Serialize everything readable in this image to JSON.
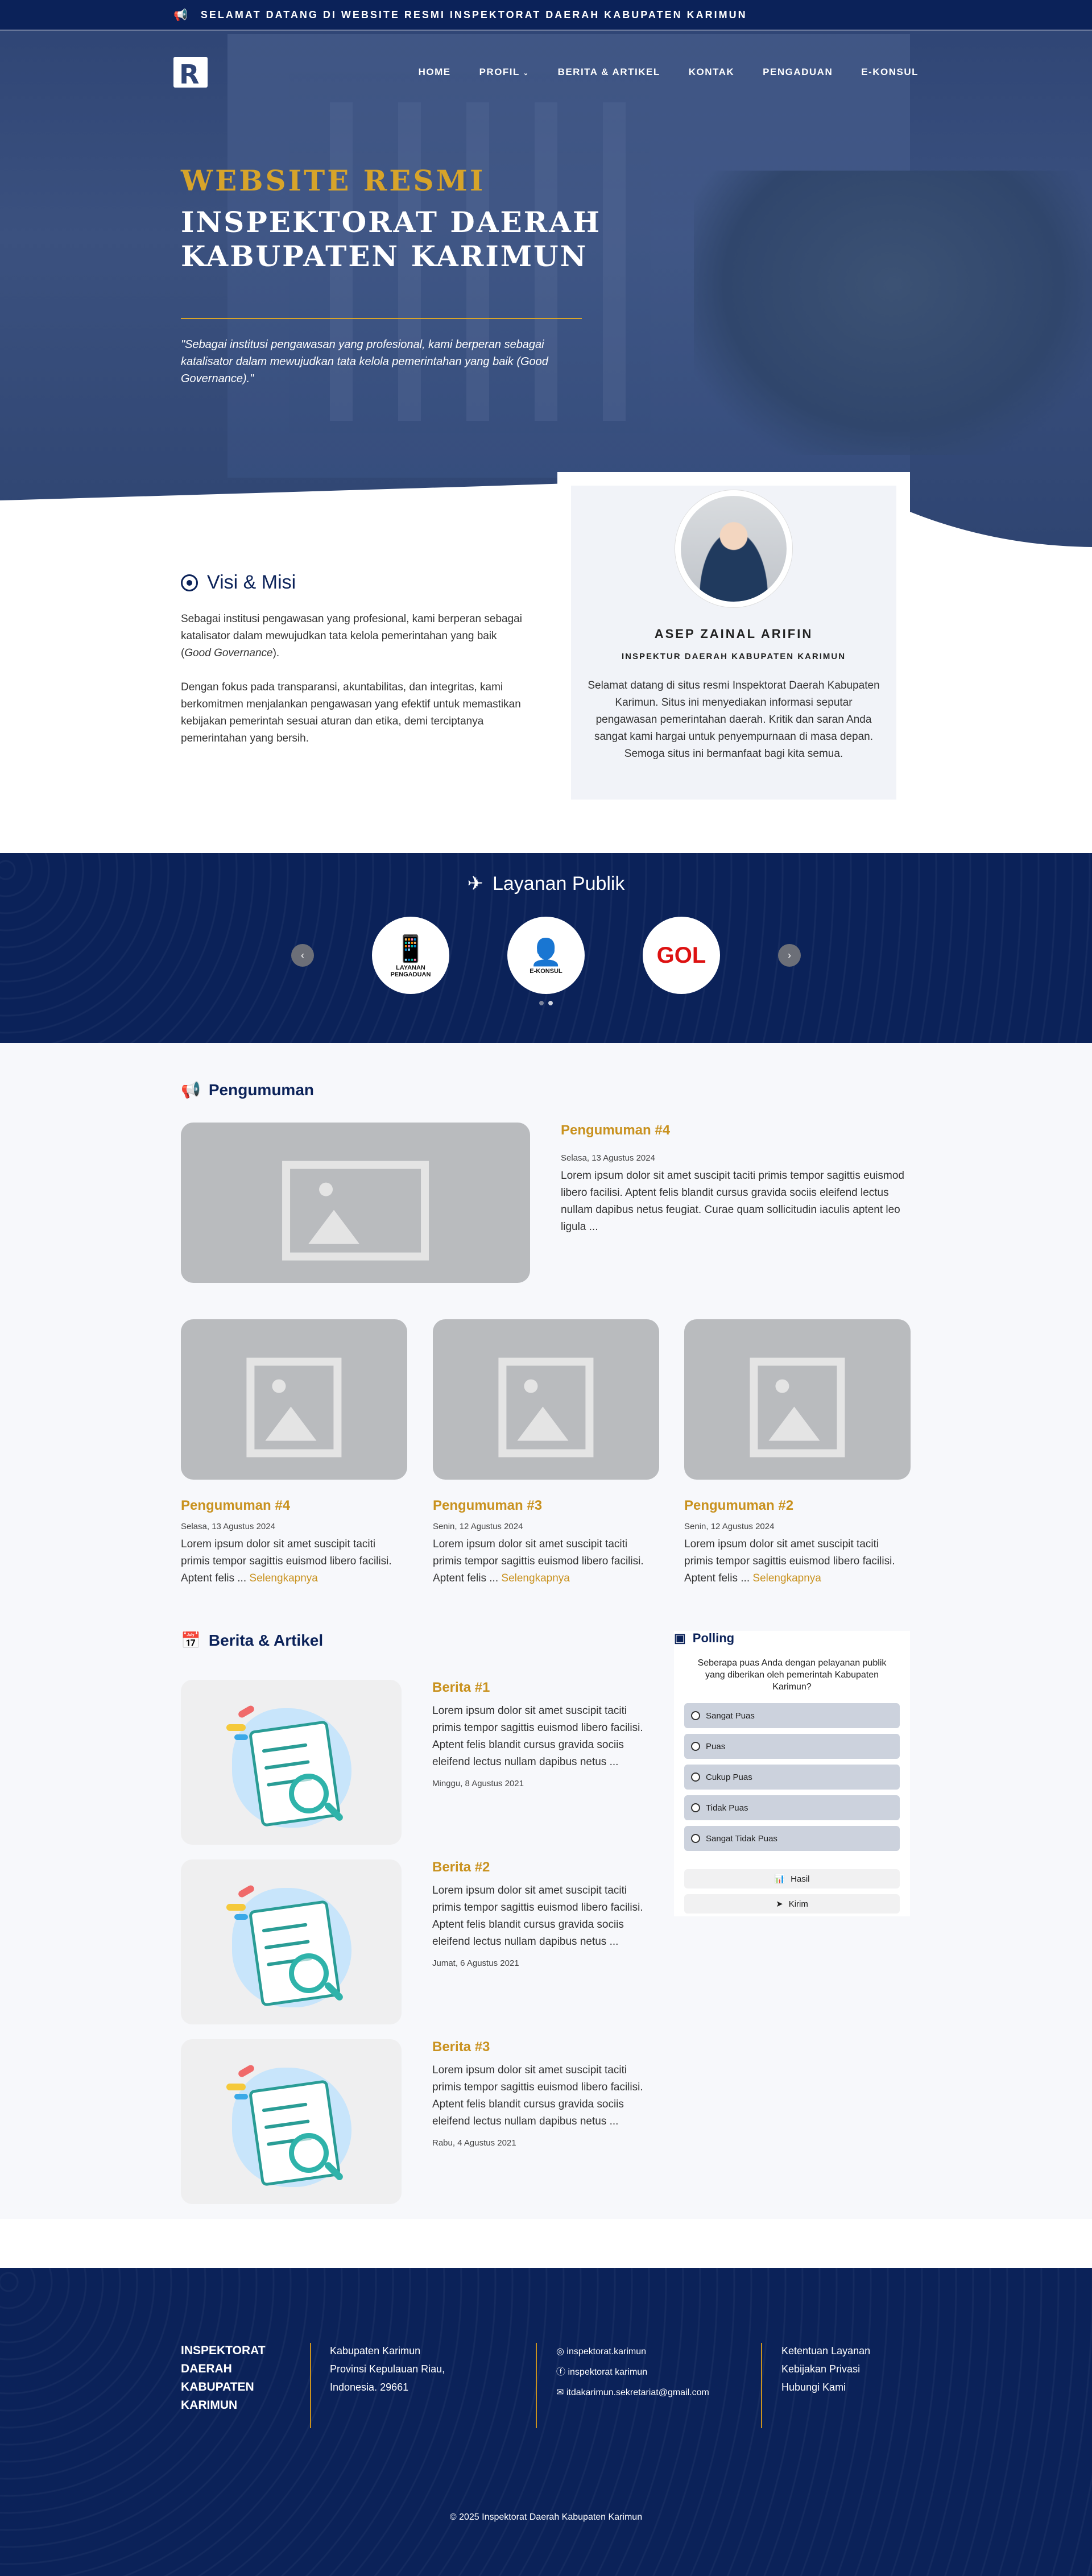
{
  "topbar": {
    "icon": "megaphone-icon",
    "text": "SELAMAT DATANG DI WEBSITE RESMI INSPEKTORAT DAERAH KABUPATEN KARIMUN"
  },
  "nav": {
    "items": [
      "HOME",
      "PROFIL",
      "BERITA & ARTIKEL",
      "KONTAK",
      "PENGADUAN",
      "E-KONSUL"
    ]
  },
  "hero": {
    "kicker": "WEBSITE RESMI",
    "title": "INSPEKTORAT DAERAH KABUPATEN KARIMUN",
    "quote": "\"Sebagai institusi pengawasan yang profesional, kami berperan sebagai katalisator dalam mewujudkan tata kelola pemerintahan yang baik (Good Governance).\""
  },
  "profile": {
    "name": "ASEP ZAINAL ARIFIN",
    "role": "INSPEKTUR DAERAH KABUPATEN KARIMUN",
    "message": "Selamat datang di situs resmi Inspektorat Daerah Kabupaten Karimun. Situs ini menyediakan informasi seputar pengawasan pemerintahan daerah. Kritik dan saran Anda sangat kami hargai untuk penyempurnaan di masa depan. Semoga situs ini bermanfaat bagi kita semua."
  },
  "visi": {
    "title": "Visi & Misi",
    "p1_pre": "Sebagai institusi pengawasan yang profesional, kami berperan sebagai katalisator dalam mewujudkan tata kelola pemerintahan yang baik (",
    "p1_em": "Good Governance",
    "p1_post": ").",
    "p2": "Dengan fokus pada transparansi, akuntabilitas, dan integritas, kami berkomitmen menjalankan pengawasan yang efektif untuk memastikan kebijakan pemerintah sesuai aturan dan etika, demi terciptanya pemerintahan yang bersih."
  },
  "layanan": {
    "title": "Layanan Publik",
    "items": [
      {
        "label": "LAYANAN PENGADUAN",
        "icon": "phone-hand-icon"
      },
      {
        "label": "E-KONSUL",
        "icon": "consult-person-icon"
      },
      {
        "label": "GOL",
        "icon": "gol-logo-icon"
      }
    ]
  },
  "pengumuman": {
    "title": "Pengumuman",
    "featured": {
      "title": "Pengumuman #4",
      "date": "Selasa, 13 Agustus 2024",
      "text": "Lorem ipsum dolor sit amet suscipit taciti primis tempor sagittis euismod libero facilisi. Aptent felis blandit cursus gravida sociis eleifend lectus nullam dapibus netus feugiat. Curae quam sollicitudin iaculis aptent leo ligula ..."
    },
    "cards": [
      {
        "title": "Pengumuman #4",
        "date": "Selasa, 13 Agustus 2024",
        "text": "Lorem ipsum dolor sit amet suscipit taciti primis tempor sagittis euismod libero facilisi. Aptent felis ...",
        "more": "Selengkapnya"
      },
      {
        "title": "Pengumuman #3",
        "date": "Senin, 12 Agustus 2024",
        "text": "Lorem ipsum dolor sit amet suscipit taciti primis tempor sagittis euismod libero facilisi. Aptent felis ...",
        "more": "Selengkapnya"
      },
      {
        "title": "Pengumuman #2",
        "date": "Senin, 12 Agustus 2024",
        "text": "Lorem ipsum dolor sit amet suscipit taciti primis tempor sagittis euismod libero facilisi. Aptent felis ...",
        "more": "Selengkapnya"
      }
    ]
  },
  "berita": {
    "title": "Berita & Artikel",
    "items": [
      {
        "title": "Berita #1",
        "text": "Lorem ipsum dolor sit amet suscipit taciti primis tempor sagittis euismod libero facilisi. Aptent felis blandit cursus gravida sociis eleifend lectus nullam dapibus netus ...",
        "date": "Minggu, 8 Agustus 2021"
      },
      {
        "title": "Berita #2",
        "text": "Lorem ipsum dolor sit amet suscipit taciti primis tempor sagittis euismod libero facilisi. Aptent felis blandit cursus gravida sociis eleifend lectus nullam dapibus netus ...",
        "date": "Jumat, 6 Agustus 2021"
      },
      {
        "title": "Berita #3",
        "text": "Lorem ipsum dolor sit amet suscipit taciti primis tempor sagittis euismod libero facilisi. Aptent felis blandit cursus gravida sociis eleifend lectus nullam dapibus netus ...",
        "date": "Rabu, 4 Agustus 2021"
      }
    ]
  },
  "polling": {
    "title": "Polling",
    "question": "Seberapa puas Anda dengan pelayanan publik yang diberikan oleh pemerintah Kabupaten Karimun?",
    "options": [
      "Sangat Puas",
      "Puas",
      "Cukup Puas",
      "Tidak Puas",
      "Sangat Tidak Puas"
    ],
    "hasil": "Hasil",
    "kirim": "Kirim"
  },
  "footer": {
    "org": "INSPEKTORAT DAERAH KABUPATEN KARIMUN",
    "addr1": "Kabupaten Karimun",
    "addr2": "Provinsi Kepulauan Riau,",
    "addr3": "Indonesia. 29661",
    "instagram": "inspektorat.karimun",
    "facebook": "inspektorat karimun",
    "email": "itdakarimun.sekretariat@gmail.com",
    "links": [
      "Ketentuan Layanan",
      "Kebijakan Privasi",
      "Hubungi Kami"
    ],
    "copyright": "© 2025 Inspektorat Daerah Kabupaten Karimun"
  },
  "colors": {
    "navy": "#0b2259",
    "gold": "#c9921f"
  }
}
